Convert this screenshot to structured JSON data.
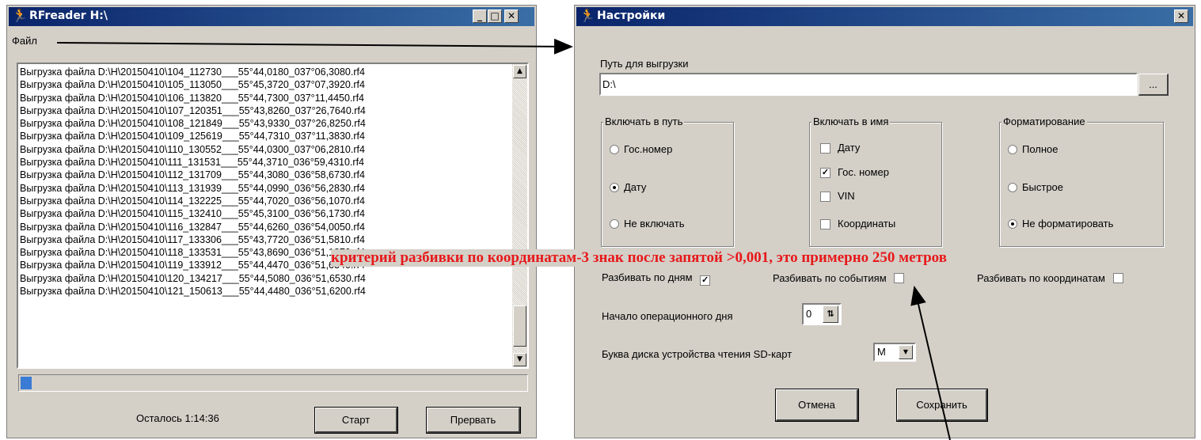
{
  "main_window": {
    "title": "RFreader  H:\\",
    "menu_file": "Файл",
    "log_lines": [
      "Выгрузка файла D:\\H\\20150410\\104_112730___55°44,0180_037°06,3080.rf4",
      "Выгрузка файла D:\\H\\20150410\\105_113050___55°45,3720_037°07,3920.rf4",
      "Выгрузка файла D:\\H\\20150410\\106_113820___55°44,7300_037°11,4450.rf4",
      "Выгрузка файла D:\\H\\20150410\\107_120351___55°43,8260_037°26,7640.rf4",
      "Выгрузка файла D:\\H\\20150410\\108_121849___55°43,9330_037°26,8250.rf4",
      "Выгрузка файла D:\\H\\20150410\\109_125619___55°44,7310_037°11,3830.rf4",
      "Выгрузка файла D:\\H\\20150410\\110_130552___55°44,0300_037°06,2810.rf4",
      "Выгрузка файла D:\\H\\20150410\\111_131531___55°44,3710_036°59,4310.rf4",
      "Выгрузка файла D:\\H\\20150410\\112_131709___55°44,3080_036°58,6730.rf4",
      "Выгрузка файла D:\\H\\20150410\\113_131939___55°44,0990_036°56,2830.rf4",
      "Выгрузка файла D:\\H\\20150410\\114_132225___55°44,7020_036°56,1070.rf4",
      "Выгрузка файла D:\\H\\20150410\\115_132410___55°45,3100_036°56,1730.rf4",
      "Выгрузка файла D:\\H\\20150410\\116_132847___55°44,6260_036°54,0050.rf4",
      "Выгрузка файла D:\\H\\20150410\\117_133306___55°43,7720_036°51,5810.rf4",
      "Выгрузка файла D:\\H\\20150410\\118_133531___55°43,8690_036°51,1870.rf4",
      "Выгрузка файла D:\\H\\20150410\\119_133912___55°44,4470_036°51,6340.rf4",
      "Выгрузка файла D:\\H\\20150410\\120_134217___55°44,5080_036°51,6530.rf4",
      "Выгрузка файла D:\\H\\20150410\\121_150613___55°44,4480_036°51,6200.rf4"
    ],
    "progress_fraction": 0.02,
    "remaining": "Осталось 1:14:36",
    "start_label": "Старт",
    "abort_label": "Прервать"
  },
  "settings_window": {
    "title": "Настройки",
    "path_label": "Путь для выгрузки",
    "path_value": "D:\\",
    "browse_label": "...",
    "group_path": {
      "legend": "Включать в путь",
      "options": [
        "Гос.номер",
        "Дату",
        "Не включать"
      ],
      "selected": 1
    },
    "group_name": {
      "legend": "Включать в имя",
      "options": [
        "Дату",
        "Гос. номер",
        "VIN",
        "Координаты"
      ],
      "checked": [
        false,
        true,
        false,
        false
      ]
    },
    "group_format": {
      "legend": "Форматирование",
      "options": [
        "Полное",
        "Быстрое",
        "Не форматировать"
      ],
      "selected": 2
    },
    "split_days_label": "Разбивать по дням",
    "split_days_checked": true,
    "split_events_label": "Разбивать по событиям",
    "split_events_checked": false,
    "split_coords_label": "Разбивать по координатам",
    "split_coords_checked": false,
    "day_start_label": "Начало операционного дня",
    "day_start_value": "0",
    "sd_drive_label": "Буква диска устройства чтения SD-карт",
    "sd_drive_value": "M",
    "cancel_label": "Отмена",
    "save_label": "Сохранить"
  },
  "annotation": {
    "text": "критерий разбивки по координатам-3 знак после запятой >0,001, это примерно 250 метров",
    "color": "#e8181a"
  },
  "icons": {
    "app": "running-man-icon",
    "minimize": "minimize-icon",
    "maximize": "maximize-icon",
    "close": "close-icon"
  }
}
